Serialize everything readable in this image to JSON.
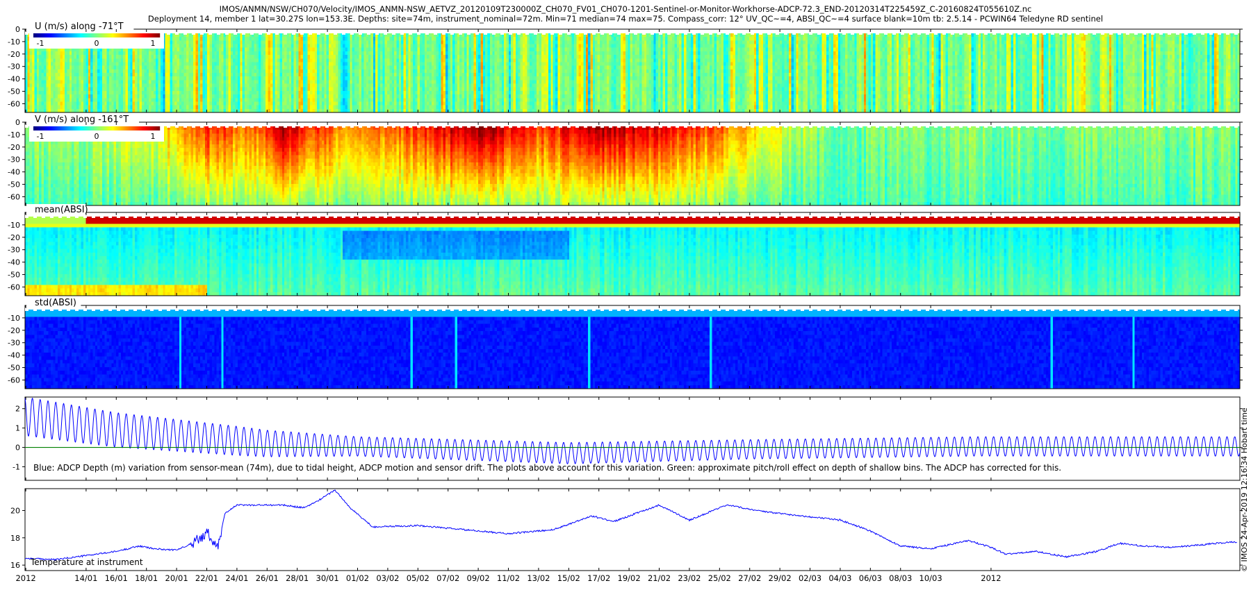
{
  "header": {
    "line1": "IMOS/ANMN/NSW/CH070/Velocity/IMOS_ANMN-NSW_AETVZ_20120109T230000Z_CH070_FV01_CH070-1201-Sentinel-or-Monitor-Workhorse-ADCP-72.3_END-20120314T225459Z_C-20160824T055610Z.nc",
    "line2": "Deployment 14, member 1 lat=30.27S lon=153.3E. Depths: site=74m, instrument_nominal=72m. Min=71 median=74 max=75. Compass_corr: 12° UV_QC~=4, ABSI_QC~=4 surface blank=10m tb: 2.5.14 - PCWIN64 Teledyne RD sentinel"
  },
  "credit": "© IMOS 24-Apr-2019 12:16:34 Hobart time",
  "chart_data": [
    {
      "type": "heatmap",
      "id": "u",
      "label": "U (m/s) along -71°T",
      "y_ticks": [
        0,
        -10,
        -20,
        -30,
        -40,
        -50,
        -60
      ],
      "colorbar": {
        "ticks": [
          "-1",
          "0",
          "1"
        ],
        "range": [
          -1.3,
          1.3
        ]
      },
      "depth_range": [
        -67,
        0
      ],
      "description_field": {
        "base_value": -0.35,
        "events": [
          {
            "day": 22.5,
            "value": 0.05
          },
          {
            "day": 34.0,
            "value": -0.15
          },
          {
            "day": 52.0,
            "value": 0.1
          },
          {
            "day": 60.0,
            "value": -0.2
          }
        ]
      }
    },
    {
      "type": "heatmap",
      "id": "v",
      "label": "V (m/s) along -161°T",
      "y_ticks": [
        0,
        -10,
        -20,
        -30,
        -40,
        -50,
        -60
      ],
      "colorbar": {
        "ticks": [
          "-1",
          "0",
          "1"
        ],
        "range": [
          -1.3,
          1.3
        ]
      },
      "depth_range": [
        -67,
        0
      ],
      "surface_value_by_day": [
        {
          "day": 14,
          "value": 0.1
        },
        {
          "day": 19,
          "value": 0.35
        },
        {
          "day": 22,
          "value": 0.9
        },
        {
          "day": 25,
          "value": 0.6
        },
        {
          "day": 27,
          "value": 1.2
        },
        {
          "day": 31,
          "value": 0.6
        },
        {
          "day": 35,
          "value": 0.75
        },
        {
          "day": 40,
          "value": 1.3
        },
        {
          "day": 44,
          "value": 0.8
        },
        {
          "day": 48,
          "value": 1.2
        },
        {
          "day": 52,
          "value": 1.0
        },
        {
          "day": 56,
          "value": 0.7
        },
        {
          "day": 60,
          "value": 0.25
        },
        {
          "day": 64,
          "value": -0.1
        },
        {
          "day": 67,
          "value": 0.0
        }
      ]
    },
    {
      "type": "heatmap",
      "id": "mean_absi",
      "label": "mean(ABSI)",
      "y_ticks": [
        -10,
        -20,
        -30,
        -40,
        -50,
        -60
      ],
      "depth_range": [
        -67,
        0
      ]
    },
    {
      "type": "heatmap",
      "id": "std_absi",
      "label": "std(ABSI)",
      "y_ticks": [
        -10,
        -20,
        -30,
        -40,
        -50,
        -60
      ],
      "depth_range": [
        -67,
        0
      ]
    },
    {
      "type": "line",
      "id": "depth",
      "y_ticks": [
        2,
        1,
        0,
        -1
      ],
      "ylim": [
        -1.7,
        2.6
      ],
      "annotation": "Blue: ADCP Depth (m) variation from sensor-mean (74m), due to tidal height, ADCP motion and sensor drift. The plots above account for this variation. Green: approximate pitch/roll effect on depth of shallow bins. The ADCP has corrected for this.",
      "series": [
        {
          "color": "#0000ff",
          "tidal_amplitude": [
            {
              "day": 10,
              "value": 1.0
            },
            {
              "day": 24,
              "value": 0.75
            },
            {
              "day": 32,
              "value": 0.5
            },
            {
              "day": 46,
              "value": 0.55
            },
            {
              "day": 58,
              "value": 0.5
            },
            {
              "day": 73,
              "value": 0.5
            }
          ],
          "mean_offset": [
            {
              "day": 10,
              "value": 1.6
            },
            {
              "day": 16,
              "value": 0.9
            },
            {
              "day": 26,
              "value": 0.2
            },
            {
              "day": 46,
              "value": -0.3
            },
            {
              "day": 58,
              "value": -0.1
            },
            {
              "day": 73,
              "value": 0.05
            }
          ],
          "period_days": 0.5175
        },
        {
          "color": "#008000",
          "value": 0.0
        }
      ]
    },
    {
      "type": "line",
      "id": "temperature",
      "y_ticks": [
        20,
        18,
        16
      ],
      "ylim": [
        15.6,
        21.6
      ],
      "annotation": "Temperature at instrument",
      "series": [
        {
          "color": "#0000ff",
          "points": [
            {
              "day": 9.95,
              "value": 16.5
            },
            {
              "day": 12,
              "value": 16.4
            },
            {
              "day": 14,
              "value": 16.7
            },
            {
              "day": 16,
              "value": 17.0
            },
            {
              "day": 17.5,
              "value": 17.4
            },
            {
              "day": 18.5,
              "value": 17.2
            },
            {
              "day": 20,
              "value": 17.1
            },
            {
              "day": 21,
              "value": 17.6
            },
            {
              "day": 22,
              "value": 18.3
            },
            {
              "day": 22.8,
              "value": 17.6
            },
            {
              "day": 23.2,
              "value": 19.8
            },
            {
              "day": 24,
              "value": 20.4
            },
            {
              "day": 27,
              "value": 20.4
            },
            {
              "day": 28.5,
              "value": 20.2
            },
            {
              "day": 29.5,
              "value": 20.8
            },
            {
              "day": 30.5,
              "value": 21.5
            },
            {
              "day": 31.5,
              "value": 20.2
            },
            {
              "day": 33,
              "value": 18.8
            },
            {
              "day": 36,
              "value": 18.9
            },
            {
              "day": 39,
              "value": 18.6
            },
            {
              "day": 42,
              "value": 18.3
            },
            {
              "day": 45,
              "value": 18.6
            },
            {
              "day": 47.5,
              "value": 19.6
            },
            {
              "day": 49,
              "value": 19.2
            },
            {
              "day": 52,
              "value": 20.4
            },
            {
              "day": 54,
              "value": 19.3
            },
            {
              "day": 56.5,
              "value": 20.4
            },
            {
              "day": 59,
              "value": 19.9
            },
            {
              "day": 64,
              "value": 19.3
            },
            {
              "day": 66,
              "value": 18.5
            },
            {
              "day": 68,
              "value": 17.4
            },
            {
              "day": 70,
              "value": 17.2
            },
            {
              "day": 72.5,
              "value": 17.8
            },
            {
              "day": 74,
              "value": 17.3
            },
            {
              "day": 75,
              "value": 16.8
            },
            {
              "day": 77,
              "value": 17.0
            },
            {
              "day": 79,
              "value": 16.6
            },
            {
              "day": 81,
              "value": 17.0
            },
            {
              "day": 82.5,
              "value": 17.6
            },
            {
              "day": 84,
              "value": 17.4
            },
            {
              "day": 86,
              "value": 17.3
            },
            {
              "day": 88,
              "value": 17.5
            },
            {
              "day": 90,
              "value": 17.7
            }
          ]
        }
      ]
    }
  ],
  "x_axis": {
    "start_day": 9.95,
    "end_day": 90.5,
    "tick_labels": [
      {
        "day": 10,
        "label": "2012"
      },
      {
        "day": 14,
        "label": "14/01"
      },
      {
        "day": 16,
        "label": "16/01"
      },
      {
        "day": 18,
        "label": "18/01"
      },
      {
        "day": 20,
        "label": "20/01"
      },
      {
        "day": 22,
        "label": "22/01"
      },
      {
        "day": 24,
        "label": "24/01"
      },
      {
        "day": 26,
        "label": "26/01"
      },
      {
        "day": 28,
        "label": "28/01"
      },
      {
        "day": 30,
        "label": "30/01"
      },
      {
        "day": 32,
        "label": "01/02"
      },
      {
        "day": 34,
        "label": "03/02"
      },
      {
        "day": 36,
        "label": "05/02"
      },
      {
        "day": 38,
        "label": "07/02"
      },
      {
        "day": 40,
        "label": "09/02"
      },
      {
        "day": 42,
        "label": "11/02"
      },
      {
        "day": 44,
        "label": "13/02"
      },
      {
        "day": 46,
        "label": "15/02"
      },
      {
        "day": 48,
        "label": "17/02"
      },
      {
        "day": 50,
        "label": "19/02"
      },
      {
        "day": 52,
        "label": "21/02"
      },
      {
        "day": 54,
        "label": "23/02"
      },
      {
        "day": 56,
        "label": "25/02"
      },
      {
        "day": 58,
        "label": "27/02"
      },
      {
        "day": 60,
        "label": "29/02"
      },
      {
        "day": 62,
        "label": "02/03"
      },
      {
        "day": 64,
        "label": "04/03"
      },
      {
        "day": 66,
        "label": "06/03"
      },
      {
        "day": 68,
        "label": "08/03"
      },
      {
        "day": 70,
        "label": "10/03"
      },
      {
        "day": 74,
        "label": "2012"
      }
    ]
  }
}
